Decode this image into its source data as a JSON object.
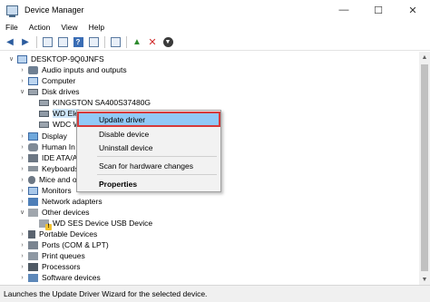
{
  "window": {
    "title": "Device Manager",
    "controls": {
      "minimize": "—",
      "maximize": "☐",
      "close": "✕"
    }
  },
  "menu": [
    "File",
    "Action",
    "View",
    "Help"
  ],
  "toolbar": {
    "back": "back-arrow-icon",
    "forward": "forward-arrow-icon"
  },
  "tree": {
    "root": "DESKTOP-9Q0JNFS",
    "items": [
      {
        "label": "Audio inputs and outputs"
      },
      {
        "label": "Computer"
      },
      {
        "label": "Disk drives"
      },
      {
        "label": "KINGSTON SA400S37480G"
      },
      {
        "label": "WD Ele"
      },
      {
        "label": "WDC W"
      },
      {
        "label": "Display"
      },
      {
        "label": "Human In"
      },
      {
        "label": "IDE ATA/ATA"
      },
      {
        "label": "Keyboards"
      },
      {
        "label": "Mice and o"
      },
      {
        "label": "Monitors"
      },
      {
        "label": "Network adapters"
      },
      {
        "label": "Other devices"
      },
      {
        "label": "WD SES Device USB Device"
      },
      {
        "label": "Portable Devices"
      },
      {
        "label": "Ports (COM & LPT)"
      },
      {
        "label": "Print queues"
      },
      {
        "label": "Processors"
      },
      {
        "label": "Software devices"
      }
    ]
  },
  "context_menu": {
    "update_driver": "Update driver",
    "disable_device": "Disable device",
    "uninstall_device": "Uninstall device",
    "scan": "Scan for hardware changes",
    "properties": "Properties"
  },
  "status": "Launches the Update Driver Wizard for the selected device."
}
